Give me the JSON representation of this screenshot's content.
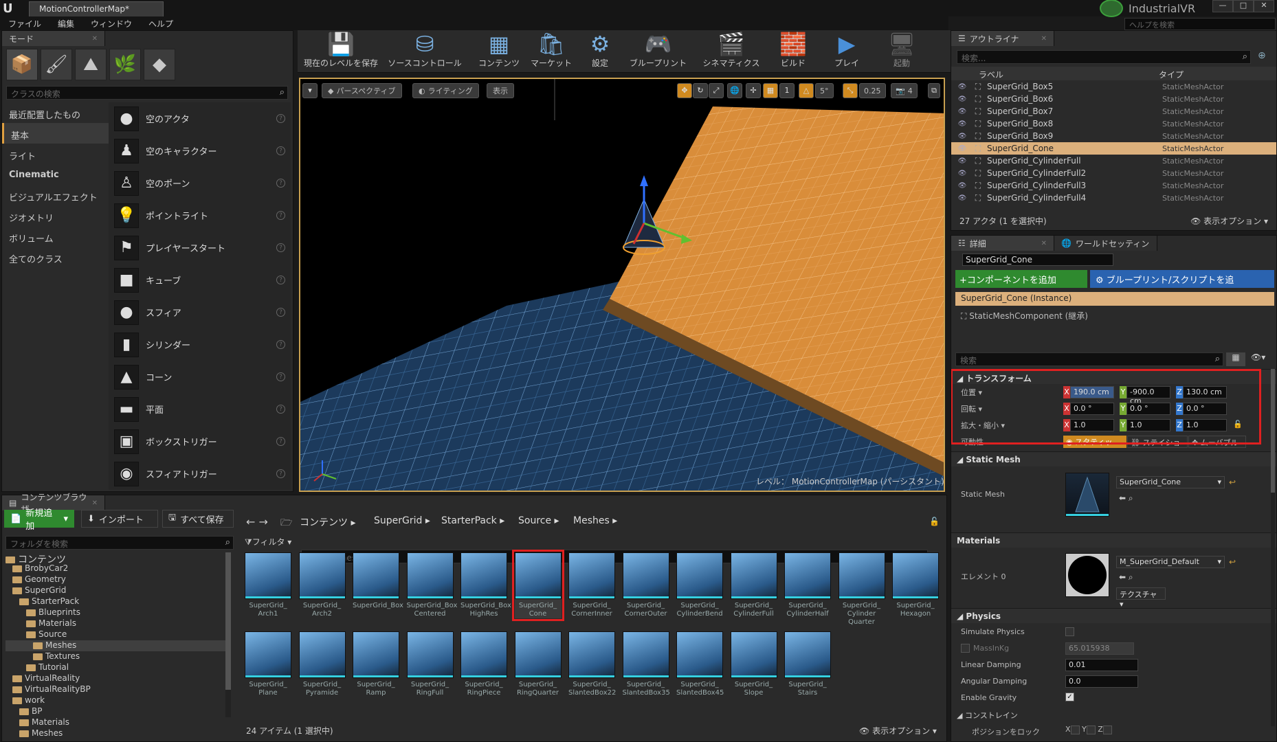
{
  "window": {
    "doc_tab": "MotionControllerMap*",
    "project": "IndustrialVR",
    "help_placeholder": "ヘルプを検索"
  },
  "menu": [
    "ファイル",
    "編集",
    "ウィンドウ",
    "ヘルプ"
  ],
  "modes": {
    "tab": "モード",
    "search_placeholder": "クラスの検索",
    "categories": [
      "最近配置したもの",
      "基本",
      "ライト",
      "Cinematic",
      "ビジュアルエフェクト",
      "ジオメトリ",
      "ボリューム",
      "全てのクラス"
    ],
    "actors": [
      "空のアクタ",
      "空のキャラクター",
      "空のポーン",
      "ポイントライト",
      "プレイヤースタート",
      "キューブ",
      "スフィア",
      "シリンダー",
      "コーン",
      "平面",
      "ボックストリガー",
      "スフィアトリガー"
    ]
  },
  "toolbar": [
    "現在のレベルを保存",
    "ソースコントロール",
    "コンテンツ",
    "マーケット",
    "設定",
    "ブループリント",
    "シネマティクス",
    "ビルド",
    "プレイ",
    "起動"
  ],
  "viewport": {
    "perspective": "パースペクティブ",
    "lighting": "ライティング",
    "show": "表示",
    "snap_angle": "5°",
    "snap_scale": "0.25",
    "cam_speed": "4",
    "level_label": "レベル：",
    "level_name": "MotionControllerMap (パーシスタント)"
  },
  "outliner": {
    "tab": "アウトライナ",
    "search_placeholder": "検索...",
    "col_label": "ラベル",
    "col_type": "タイプ",
    "rows": [
      {
        "label": "SuperGrid_Box5",
        "type": "StaticMeshActor"
      },
      {
        "label": "SuperGrid_Box6",
        "type": "StaticMeshActor"
      },
      {
        "label": "SuperGrid_Box7",
        "type": "StaticMeshActor"
      },
      {
        "label": "SuperGrid_Box8",
        "type": "StaticMeshActor"
      },
      {
        "label": "SuperGrid_Box9",
        "type": "StaticMeshActor"
      },
      {
        "label": "SuperGrid_Cone",
        "type": "StaticMeshActor"
      },
      {
        "label": "SuperGrid_CylinderFull",
        "type": "StaticMeshActor"
      },
      {
        "label": "SuperGrid_CylinderFull2",
        "type": "StaticMeshActor"
      },
      {
        "label": "SuperGrid_CylinderFull3",
        "type": "StaticMeshActor"
      },
      {
        "label": "SuperGrid_CylinderFull4",
        "type": "StaticMeshActor"
      }
    ],
    "footer": "27 アクタ (1 を選択中)",
    "view_options": "表示オプション"
  },
  "details": {
    "tab": "詳細",
    "tab2": "ワールドセッティン",
    "name": "SuperGrid_Cone",
    "add_component": "+コンポーネントを追加",
    "blueprint_button": "ブループリント/スクリプトを追",
    "instance": "SuperGrid_Cone (Instance)",
    "component": "StaticMeshComponent (継承)",
    "search_placeholder": "検索",
    "transform": {
      "title": "トランスフォーム",
      "location_label": "位置",
      "rotation_label": "回転",
      "scale_label": "拡大・縮小",
      "mobility_label": "可動性",
      "location": [
        "190.0 cm",
        "-900.0 cm",
        "130.0 cm"
      ],
      "rotation": [
        "0.0 °",
        "0.0 °",
        "0.0 °"
      ],
      "scale": [
        "1.0",
        "1.0",
        "1.0"
      ],
      "mobility": [
        "スタティッ",
        "ステイショ",
        "ムーバブル"
      ]
    },
    "static_mesh_section": "Static Mesh",
    "static_mesh_label": "Static Mesh",
    "static_mesh_value": "SuperGrid_Cone",
    "materials_section": "Materials",
    "element_label": "エレメント 0",
    "material_value": "M_SuperGrid_Default",
    "texture_button": "テクスチャ",
    "physics_section": "Physics",
    "simulate_physics": "Simulate Physics",
    "mass_label": "MassInKg",
    "mass_value": "65.015938",
    "linear_damping_label": "Linear Damping",
    "linear_damping": "0.01",
    "angular_damping_label": "Angular Damping",
    "angular_damping": "0.0",
    "enable_gravity": "Enable Gravity",
    "constraints_section": "コンストレイン",
    "lock_position": "ポジションをロック"
  },
  "content": {
    "tab": "コンテンツブラウザ",
    "add_new": "新規追加",
    "import": "インポート",
    "save_all": "すべて保存",
    "breadcrumb": [
      "コンテンツ",
      "SuperGrid",
      "StarterPack",
      "Source",
      "Meshes"
    ],
    "folder_search": "フォルダを検索",
    "filter": "フィルタ",
    "asset_search": "検索 Meshes",
    "tree": [
      "コンテンツ",
      "BrobyCar2",
      "Geometry",
      "SuperGrid",
      "StarterPack",
      "Blueprints",
      "Materials",
      "Source",
      "Meshes",
      "Textures",
      "Tutorial",
      "VirtualReality",
      "VirtualRealityBP",
      "work",
      "BP",
      "Materials",
      "Meshes"
    ],
    "assets": [
      "SuperGrid_\nArch1",
      "SuperGrid_\nArch2",
      "SuperGrid_Box",
      "SuperGrid_Box\nCentered",
      "SuperGrid_Box\nHighRes",
      "SuperGrid_\nCone",
      "SuperGrid_\nCornerInner",
      "SuperGrid_\nCornerOuter",
      "SuperGrid_\nCylinderBend",
      "SuperGrid_\nCylinderFull",
      "SuperGrid_\nCylinderHalf",
      "SuperGrid_\nCylinder\nQuarter",
      "SuperGrid_\nHexagon",
      "SuperGrid_\nPlane",
      "SuperGrid_\nPyramide",
      "SuperGrid_\nRamp",
      "SuperGrid_\nRingFull",
      "SuperGrid_\nRingPiece",
      "SuperGrid_\nRingQuarter",
      "SuperGrid_\nSlantedBox22",
      "SuperGrid_\nSlantedBox35",
      "SuperGrid_\nSlantedBox45",
      "SuperGrid_\nSlope",
      "SuperGrid_\nStairs"
    ],
    "footer": "24 アイテム (1 選択中)",
    "view_options": "表示オプション"
  },
  "colors": {
    "accent": "#e0a040",
    "selection": "#dcb07c",
    "highlight_box": "#e02020",
    "button_green": "#2f8a2f",
    "button_blue": "#2a63b0"
  }
}
